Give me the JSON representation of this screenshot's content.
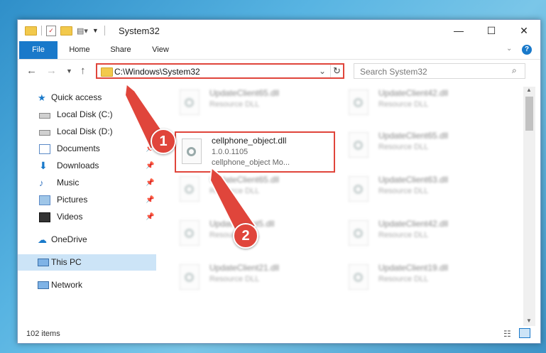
{
  "window": {
    "title": "System32",
    "controls": {
      "minimize": "—",
      "maximize": "☐",
      "close": "✕"
    }
  },
  "ribbon": {
    "tabs": [
      "File",
      "Home",
      "Share",
      "View"
    ],
    "help": "?"
  },
  "address": {
    "path": "C:\\Windows\\System32",
    "search_placeholder": "Search System32"
  },
  "sidebar": {
    "quick_access": "Quick access",
    "items": [
      {
        "label": "Local Disk (C:)",
        "pinned": false
      },
      {
        "label": "Local Disk (D:)",
        "pinned": true
      },
      {
        "label": "Documents",
        "pinned": true
      },
      {
        "label": "Downloads",
        "pinned": true
      },
      {
        "label": "Music",
        "pinned": true
      },
      {
        "label": "Pictures",
        "pinned": true
      },
      {
        "label": "Videos",
        "pinned": true
      }
    ],
    "onedrive": "OneDrive",
    "this_pc": "This PC",
    "network": "Network"
  },
  "files": {
    "focus": {
      "name": "cellphone_object.dll",
      "version": "1.0.0.1105",
      "description": "cellphone_object Mo..."
    },
    "blurred": [
      {
        "name": "UpdateClient65.dll",
        "type": "Resource DLL"
      },
      {
        "name": "UpdateClient42.dll",
        "type": "Resource DLL"
      },
      {
        "name": "UpdateClient65.dll",
        "type": "Resource DLL"
      },
      {
        "name": "UpdateClient65.dll",
        "type": "Resource DLL"
      },
      {
        "name": "UpdateClient63.dll",
        "type": "Resource DLL"
      },
      {
        "name": "UpdateClient5.dll",
        "type": "Resource DLL"
      },
      {
        "name": "UpdateClient42.dll",
        "type": "Resource DLL"
      },
      {
        "name": "UpdateClient21.dll",
        "type": "Resource DLL"
      },
      {
        "name": "UpdateClient19.dll",
        "type": "Resource DLL"
      }
    ]
  },
  "status": {
    "item_count": "102 items"
  },
  "annotations": {
    "step1": "1",
    "step2": "2"
  },
  "colors": {
    "accent": "#1979ca",
    "highlight": "#e0453b",
    "selected": "#cce4f7"
  }
}
